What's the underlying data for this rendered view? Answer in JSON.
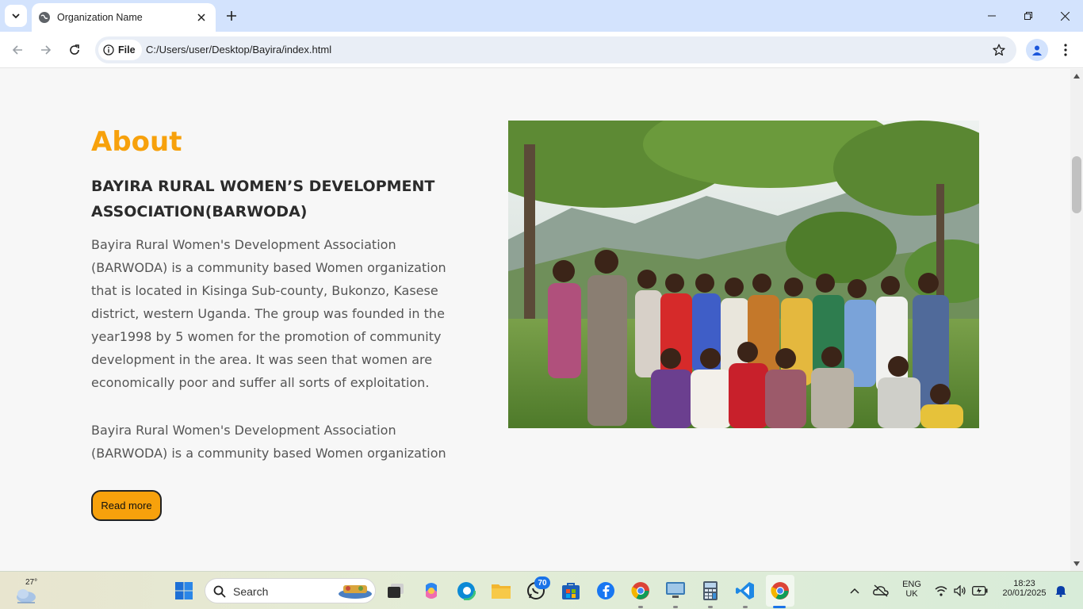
{
  "browser": {
    "tab_title": "Organization Name",
    "url_scheme_label": "File",
    "url": "C:/Users/user/Desktop/Bayira/index.html"
  },
  "page": {
    "section_title": "About",
    "subtitle": "BAYIRA RURAL WOMEN’S DEVELOPMENT ASSOCIATION(BARWODA)",
    "paragraph_1": "Bayira Rural Women's Development Association (BARWODA) is a community based Women organization that is located in Kisinga Sub-county, Bukonzo, Kasese district, western Uganda. The group was founded in the year1998 by 5 women for the promotion of community development in the area. It was seen that women are economically poor and suffer all sorts of exploitation.",
    "paragraph_2": "Bayira Rural Women's Development Association (BARWODA) is a community based Women organization",
    "read_more_label": "Read more",
    "accent_color": "#f7a10c"
  },
  "taskbar": {
    "temperature": "27°",
    "search_label": "Search",
    "whatsapp_badge": "70",
    "language_line1": "ENG",
    "language_line2": "UK",
    "time": "18:23",
    "date": "20/01/2025"
  }
}
